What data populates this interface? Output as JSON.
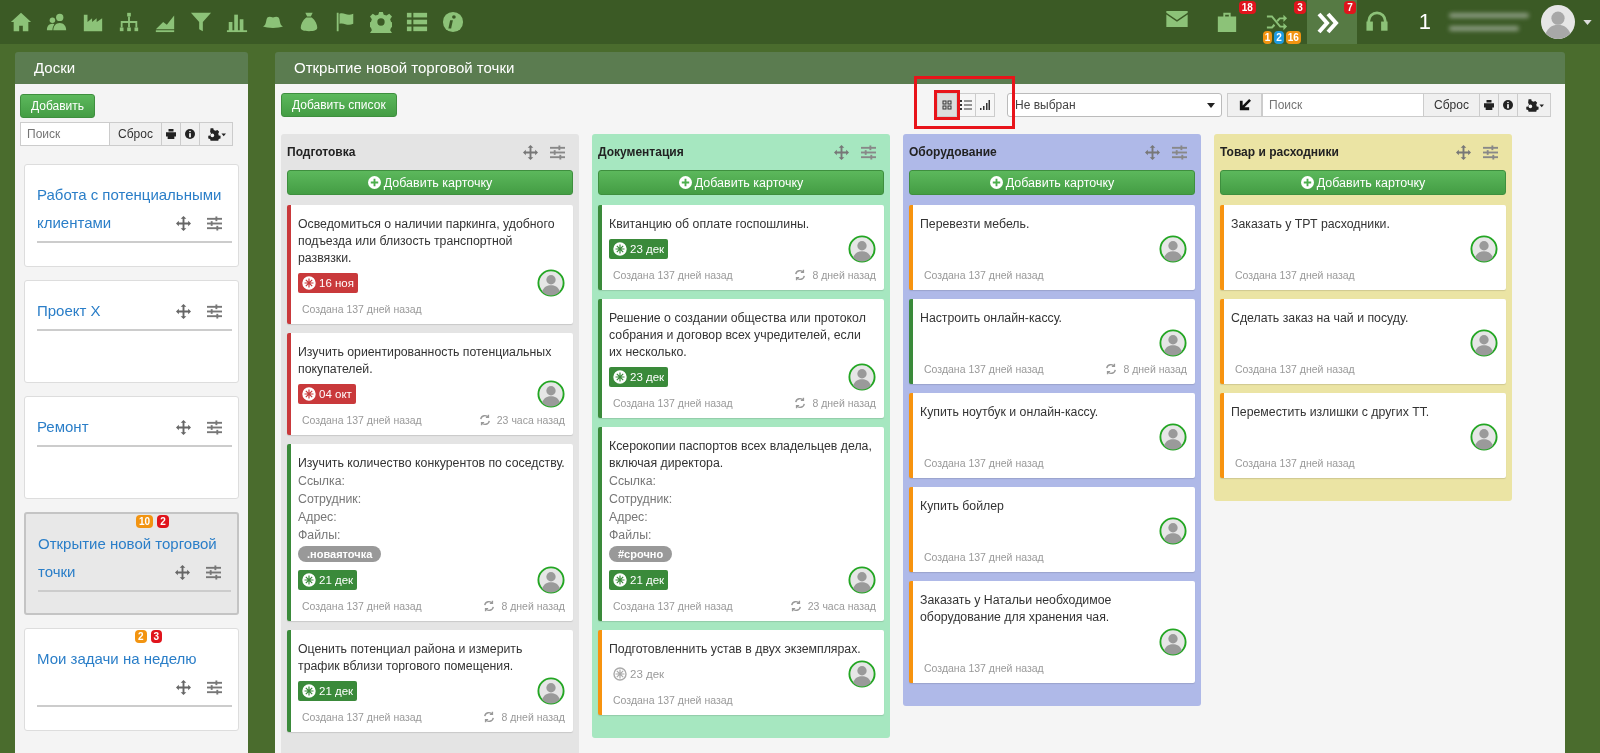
{
  "header_right": {
    "items": [
      {
        "kind": "mail",
        "selected": false
      },
      {
        "kind": "briefcase",
        "selected": false,
        "badge": "18"
      },
      {
        "kind": "shuffle",
        "selected": false,
        "badge": "3",
        "sub_badges": [
          {
            "text": "1",
            "color": "#f29411"
          },
          {
            "text": "2",
            "color": "#1e9be0"
          },
          {
            "text": "16",
            "color": "#f29411"
          }
        ]
      },
      {
        "kind": "chevrons",
        "selected": true,
        "badge": "7"
      },
      {
        "kind": "headset",
        "selected": false
      }
    ],
    "counter": "1"
  },
  "sidebar": {
    "title": "Доски",
    "add_button": "Добавить",
    "search": {
      "placeholder": "Поиск"
    },
    "reset_button": "Сброс",
    "boards": [
      {
        "title": "Работа с потенциальными клиентами",
        "selected": false
      },
      {
        "title": "Проект X",
        "selected": false
      },
      {
        "title": "Ремонт",
        "selected": false
      },
      {
        "title": "Открытие новой торговой точки",
        "selected": true,
        "badges": [
          {
            "text": "10",
            "color": "#f29411"
          },
          {
            "text": "2",
            "color": "#e0141c"
          }
        ]
      },
      {
        "title": "Мои задачи на неделю",
        "selected": false,
        "badges": [
          {
            "text": "2",
            "color": "#f29411"
          },
          {
            "text": "3",
            "color": "#e0141c"
          }
        ]
      }
    ]
  },
  "board": {
    "title": "Открытие новой торговой точки",
    "add_list_button": "Добавить список",
    "view_buttons": [
      {
        "kind": "grid",
        "selected": true,
        "highlighted": true
      },
      {
        "kind": "list",
        "selected": false,
        "highlighted": false
      },
      {
        "kind": "bars",
        "selected": false,
        "highlighted": false
      }
    ],
    "filter_select": {
      "value": "Не выбран"
    },
    "search": {
      "placeholder": "Поиск"
    },
    "reset_button": "Сброс",
    "lists": [
      {
        "title": "Подготовка",
        "color": "#e4e4e4",
        "add_card_button": "Добавить карточку",
        "cards": [
          {
            "text": "Осведомиться о наличии паркинга, удобного подъезда или близость транспортной развязки.",
            "color": "#c9393b",
            "due": {
              "text": "16 ноя",
              "kind": "overdue"
            },
            "created": "Создана 137 дней назад"
          },
          {
            "text": "Изучить ориентированность потенциальных покупателей.",
            "color": "#c9393b",
            "due": {
              "text": "04 окт",
              "kind": "overdue"
            },
            "created": "Создана 137 дней назад",
            "updated": "23 часа назад"
          },
          {
            "text": "Изучить количество конкурентов по соседству.",
            "color": "#3a8a3a",
            "fields": [
              "Ссылка:",
              "Сотрудник:",
              "Адрес:",
              "Файлы:"
            ],
            "tag": ".новаяточка",
            "due": {
              "text": "21 дек",
              "kind": "upcoming"
            },
            "created": "Создана 137 дней назад",
            "updated": "8 дней назад"
          },
          {
            "text": "Оценить потенциал района и измерить трафик вблизи торгового помещения.",
            "color": "#3a8a3a",
            "due": {
              "text": "21 дек",
              "kind": "upcoming"
            },
            "created": "Создана 137 дней назад",
            "updated": "8 дней назад"
          }
        ]
      },
      {
        "title": "Документация",
        "color": "#a6e7c0",
        "add_card_button": "Добавить карточку",
        "cards": [
          {
            "text": "Квитанцию об оплате госпошлины.",
            "color": "#3a8a3a",
            "due": {
              "text": "23 дек",
              "kind": "upcoming"
            },
            "created": "Создана 137 дней назад",
            "updated": "8 дней назад"
          },
          {
            "text": "Решение о создании общества или протокол собрания и договор всех учредителей, если их несколько.",
            "color": "#3a8a3a",
            "due": {
              "text": "23 дек",
              "kind": "upcoming"
            },
            "created": "Создана 137 дней назад",
            "updated": "8 дней назад"
          },
          {
            "text": "Ксерокопии паспортов всех владельцев дела, включая директора.",
            "color": "#3a8a3a",
            "fields": [
              "Ссылка:",
              "Сотрудник:",
              "Адрес:",
              "Файлы:"
            ],
            "tag": "#срочно",
            "due": {
              "text": "21 дек",
              "kind": "upcoming"
            },
            "created": "Создана 137 дней назад",
            "updated": "23 часа назад"
          },
          {
            "text": "Подготовленнить устав в двух экземплярах.",
            "color": "#f7930f",
            "due": {
              "text": "23 дек",
              "kind": "plain"
            },
            "created": "Создана 137 дней назад"
          }
        ]
      },
      {
        "title": "Оборудование",
        "color": "#afb9e8",
        "add_card_button": "Добавить карточку",
        "cards": [
          {
            "text": "Перевезти мебель.",
            "color": "#f7930f",
            "created": "Создана 137 дней назад"
          },
          {
            "text": "Настроить онлайн-кассу.",
            "color": "#3a8a3a",
            "created": "Создана 137 дней назад",
            "updated": "8 дней назад"
          },
          {
            "text": "Купить ноутбук и онлайн-кассу.",
            "color": "#f7930f",
            "created": "Создана 137 дней назад"
          },
          {
            "text": "Купить бойлер",
            "color": "#f7930f",
            "created": "Создана 137 дней назад"
          },
          {
            "text": "Заказать у Натальи необходимое оборудование для хранения чая.",
            "color": "#f7930f",
            "created": "Создана 137 дней назад"
          }
        ]
      },
      {
        "title": "Товар и расходники",
        "color": "#ebe4a4",
        "add_card_button": "Добавить карточку",
        "cards": [
          {
            "text": "Заказать у ТРТ расходники.",
            "color": "#f7930f",
            "created": "Создана 137 дней назад"
          },
          {
            "text": "Сделать заказ на чай и посуду.",
            "color": "#f7930f",
            "created": "Создана 137 дней назад"
          },
          {
            "text": "Переместить излишки с других ТТ.",
            "color": "#f7930f",
            "created": "Создана 137 дней назад"
          }
        ]
      }
    ]
  }
}
